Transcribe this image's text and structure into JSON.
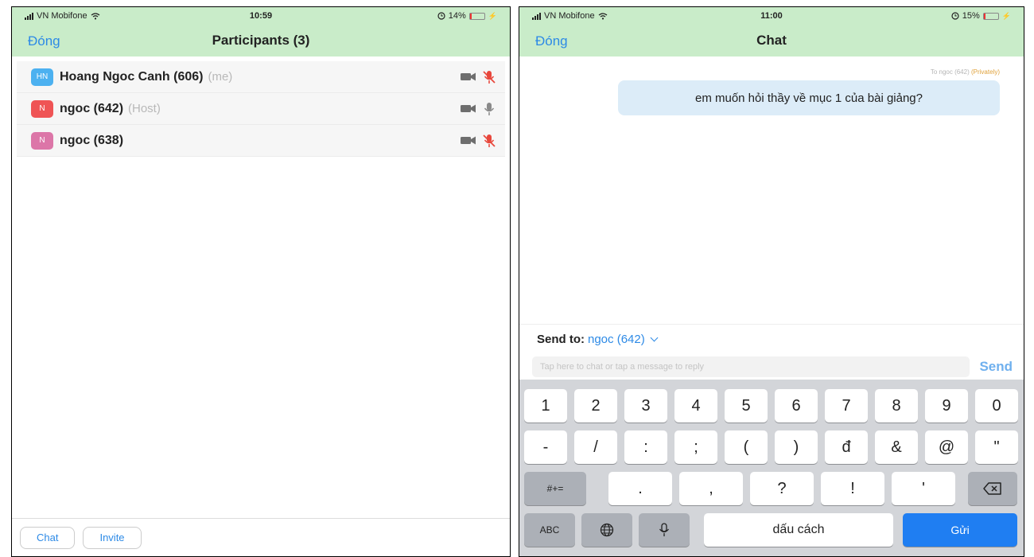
{
  "colors": {
    "header_green": "#c9ecc9",
    "link_blue": "#2d8ae6",
    "avatar_blue": "#4cb1f0",
    "avatar_red": "#ef5455",
    "avatar_pink": "#dc76a8",
    "mic_muted_red": "#e8473c",
    "keyboard_bg": "#d3d5d9",
    "send_key_blue": "#1f7ef2",
    "bubble_blue": "#dcecf8"
  },
  "left_screen": {
    "status": {
      "carrier": "VN Mobifone",
      "time": "10:59",
      "battery": "14%",
      "battery_level": 0.14
    },
    "nav": {
      "close_label": "Đóng",
      "title": "Participants (3)"
    },
    "participants": [
      {
        "initials": "HN",
        "name": "Hoang Ngoc Canh (606)",
        "tag": "(me)",
        "avatar_color": "#4cb1f0",
        "mic_muted": true,
        "icons": [
          "video-camera-icon",
          "microphone-muted-icon"
        ]
      },
      {
        "initials": "N",
        "name": "ngoc (642)",
        "tag": "(Host)",
        "avatar_color": "#ef5455",
        "mic_muted": false,
        "icons": [
          "video-camera-icon",
          "microphone-icon"
        ]
      },
      {
        "initials": "N",
        "name": "ngoc (638)",
        "tag": "",
        "avatar_color": "#dc76a8",
        "mic_muted": true,
        "icons": [
          "video-camera-icon",
          "microphone-muted-icon"
        ]
      }
    ],
    "bottom": {
      "chat_label": "Chat",
      "invite_label": "Invite"
    }
  },
  "right_screen": {
    "status": {
      "carrier": "VN Mobifone",
      "time": "11:00",
      "battery": "15%",
      "battery_level": 0.15
    },
    "nav": {
      "close_label": "Đóng",
      "title": "Chat"
    },
    "message": {
      "recipient": "To ngoc (642)",
      "privacy": "(Privately)",
      "text": "em muốn hỏi thầy về mục 1 của bài giảng?"
    },
    "send_to": {
      "label": "Send to:",
      "recipient": "ngoc (642)"
    },
    "input": {
      "placeholder": "Tap here to chat or tap a message to reply",
      "value": ""
    },
    "send_label": "Send",
    "keyboard": {
      "row1": [
        "1",
        "2",
        "3",
        "4",
        "5",
        "6",
        "7",
        "8",
        "9",
        "0"
      ],
      "row2": [
        "-",
        "/",
        ":",
        ";",
        "(",
        ")",
        "đ",
        "&",
        "@",
        "\""
      ],
      "row3": {
        "toggle": "#+=",
        "keys": [
          ".",
          ",",
          "?",
          "!",
          "'"
        ],
        "backspace_icon": "backspace-icon"
      },
      "row4": {
        "abc": "ABC",
        "globe_icon": "globe-icon",
        "mic_icon": "microphone-icon",
        "space": "dấu cách",
        "return": "Gửi"
      }
    }
  }
}
